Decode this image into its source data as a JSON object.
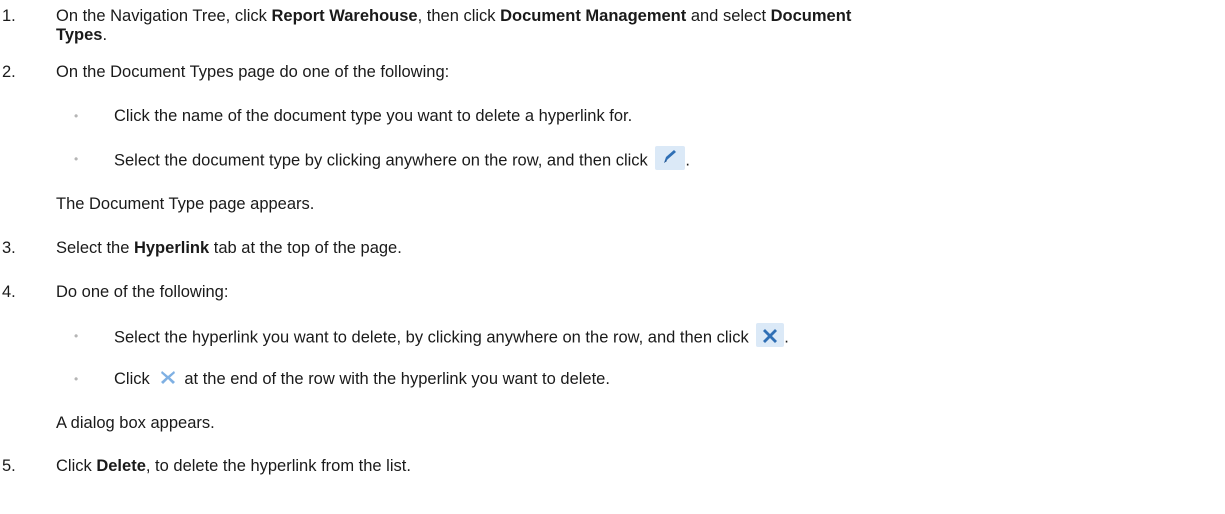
{
  "steps": [
    {
      "number": "1.",
      "line1_prefix": "On the Navigation Tree, click ",
      "line1_bold1": "Report Warehouse",
      "line1_mid": ", then click ",
      "line1_bold2": "Document Management",
      "line1_mid2": " and select ",
      "line1_bold3": "Document",
      "line2_bold": "Types",
      "line2_suffix": "."
    },
    {
      "number": "2.",
      "text": "On the Document Types page do one of the following:",
      "bullets": [
        "Click the name of the document type you want to delete a hyperlink for.",
        "Select the document type by clicking anywhere on the row, and then click "
      ],
      "bullet2_suffix": ".",
      "note": "The Document Type page appears."
    },
    {
      "number": "3.",
      "prefix": "Select the ",
      "bold": "Hyperlink",
      "suffix": " tab at the top of the page."
    },
    {
      "number": "4.",
      "text": "Do one of the following:",
      "bullet1": "Select the hyperlink you want to delete, by clicking anywhere on the row, and then click ",
      "bullet1_suffix": ".",
      "bullet2_prefix": "Click ",
      "bullet2_suffix": "at the end of the row with the hyperlink you want to delete.",
      "note": "A dialog box appears."
    },
    {
      "number": "5.",
      "prefix": "Click ",
      "bold": "Delete",
      "suffix": ", to delete the hyperlink from the list."
    }
  ],
  "bullet_char": "•",
  "icons": [
    "edit-pencil-icon",
    "delete-x-icon"
  ],
  "colors": {
    "icon_bg": "#dbe9f7",
    "icon_blue": "#2f6fb5",
    "bullet": "#b5b5b5"
  }
}
